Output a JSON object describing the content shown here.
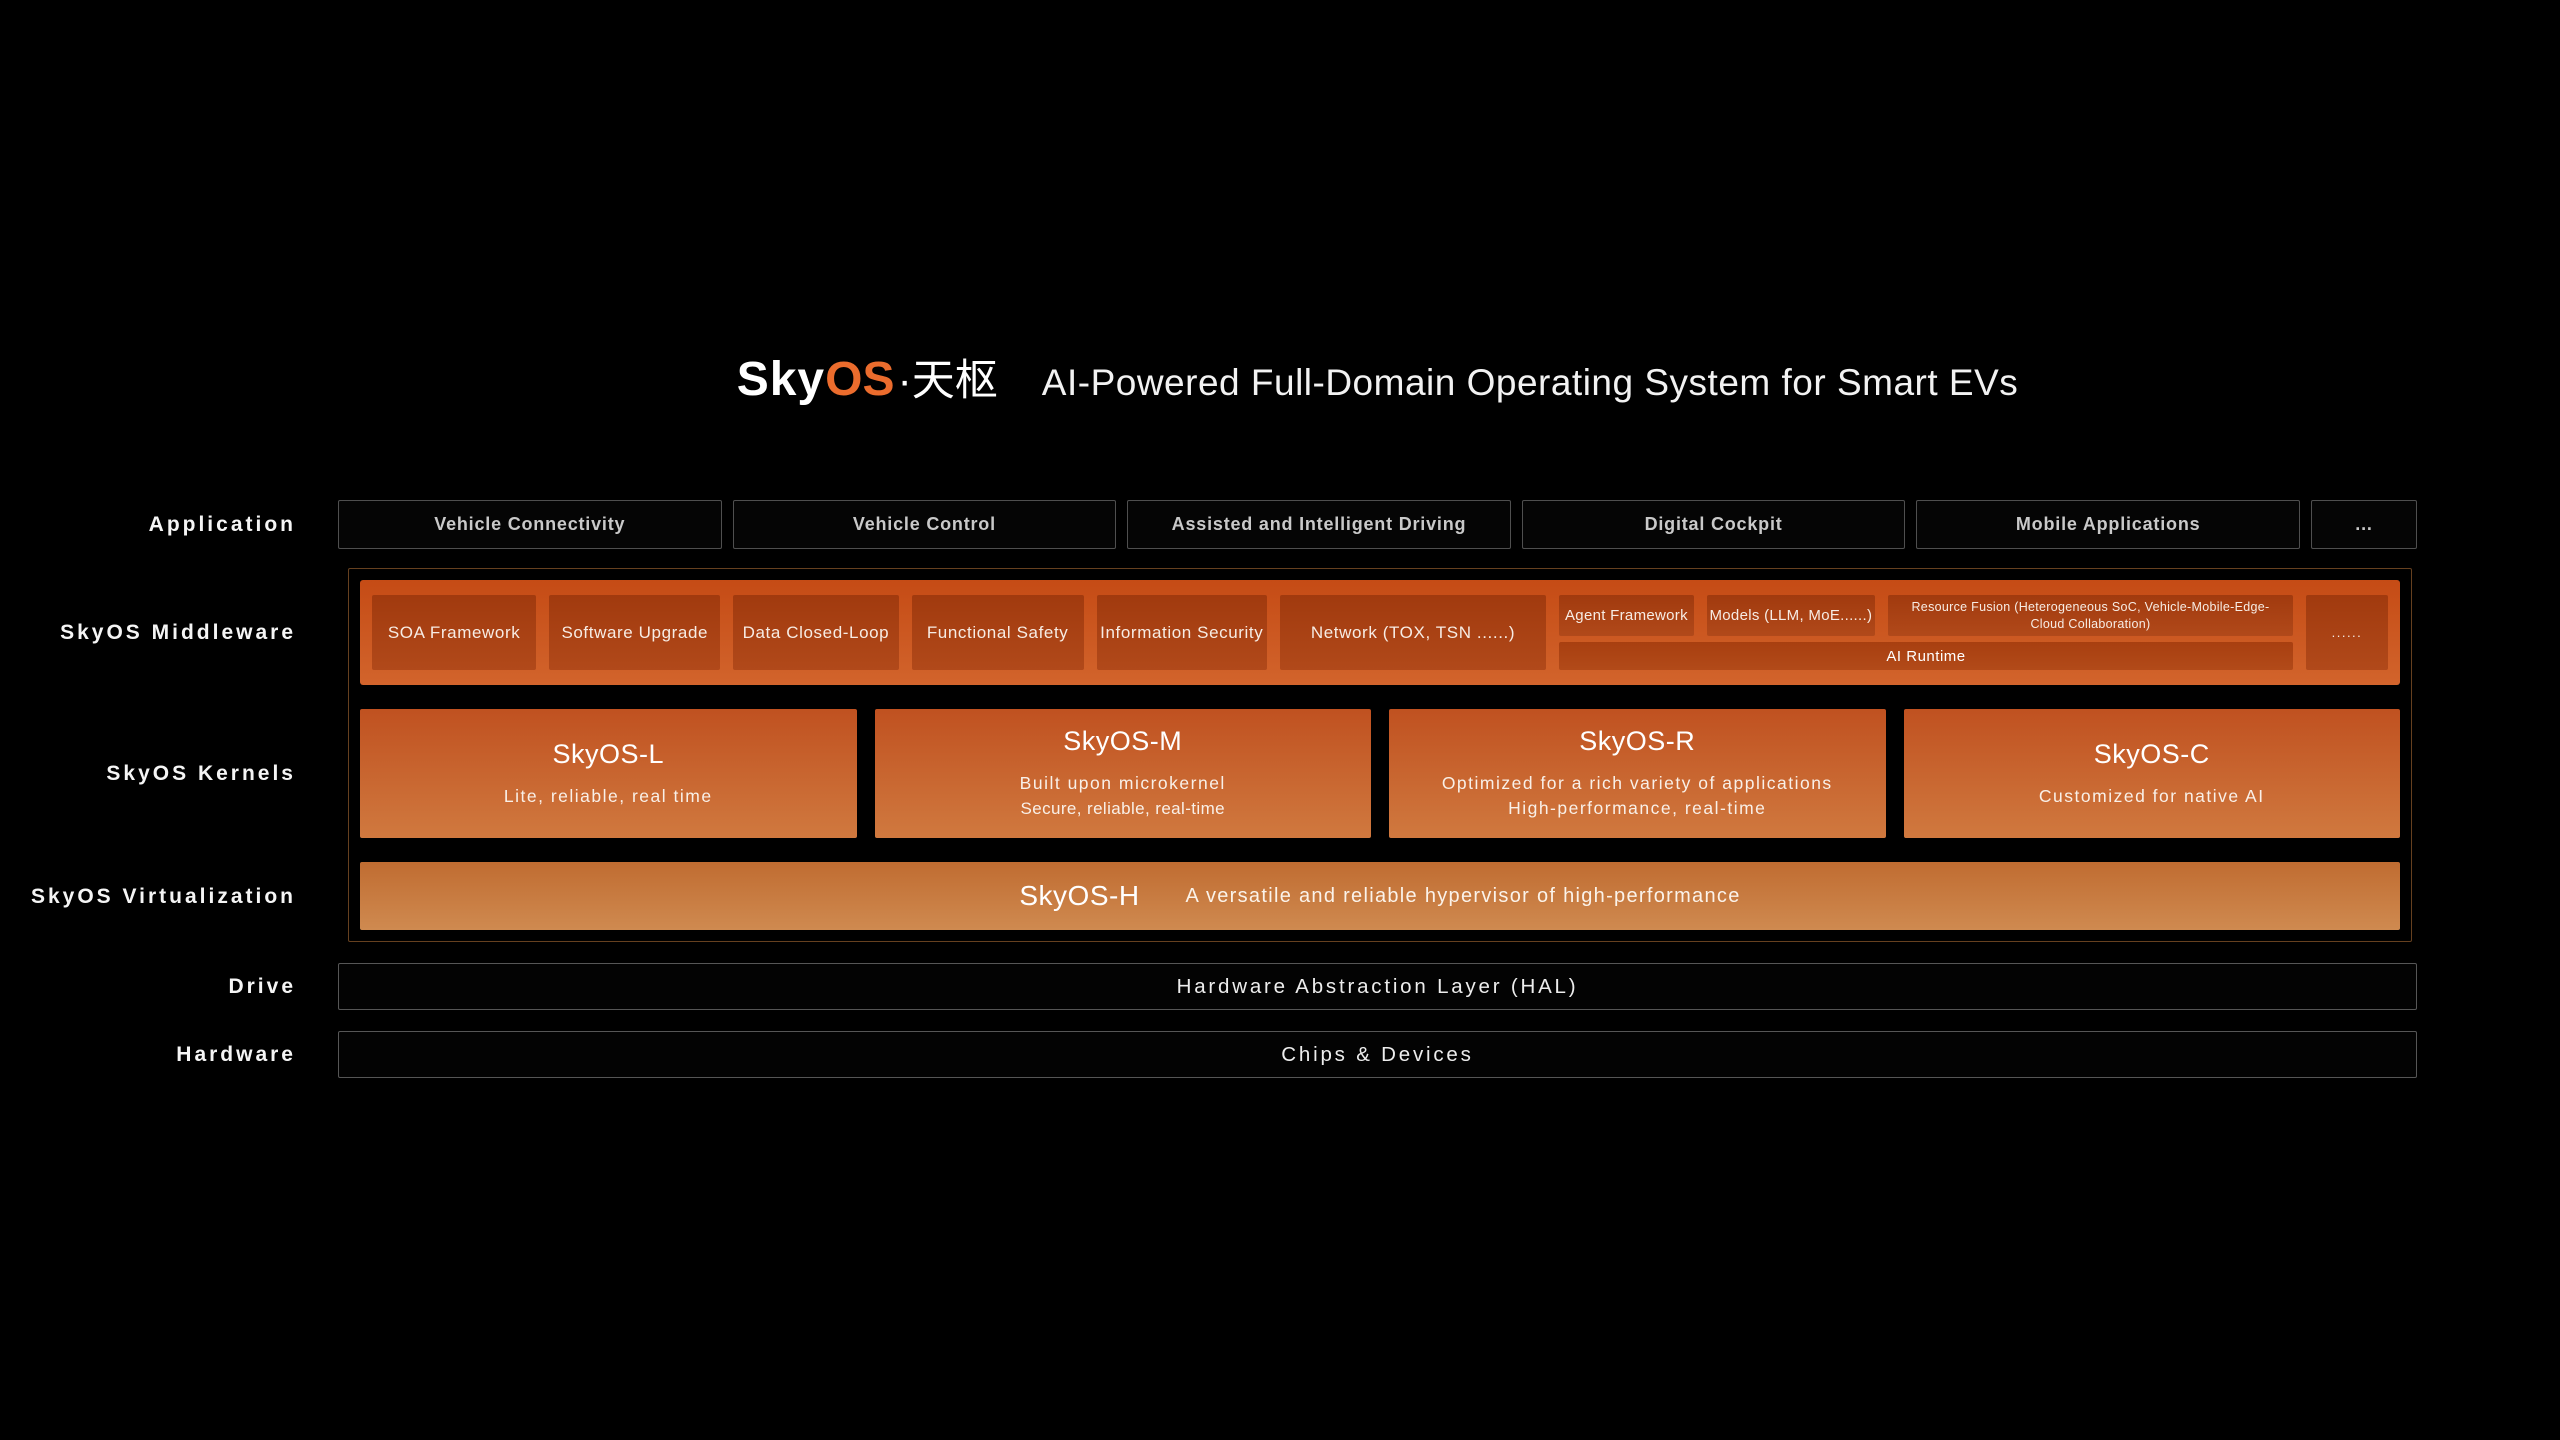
{
  "title": {
    "logo_sky": "Sky",
    "logo_os": "OS",
    "logo_cn": "·天枢",
    "subtitle": "AI-Powered Full-Domain Operating System for Smart EVs"
  },
  "rows": {
    "application": {
      "label": "Application",
      "items": [
        "Vehicle Connectivity",
        "Vehicle Control",
        "Assisted and Intelligent Driving",
        "Digital Cockpit",
        "Mobile Applications",
        "..."
      ]
    },
    "middleware": {
      "label": "SkyOS Middleware",
      "items": [
        "SOA Framework",
        "Software Upgrade",
        "Data Closed-Loop",
        "Functional Safety",
        "Information Security",
        "Network (TOX, TSN ......)"
      ],
      "ai_items": [
        "Agent Framework",
        "Models (LLM, MoE......)",
        "Resource Fusion (Heterogeneous SoC, Vehicle-Mobile-Edge-Cloud Collaboration)"
      ],
      "ai_runtime": "AI Runtime",
      "more": "......"
    },
    "kernels": {
      "label": "SkyOS Kernels",
      "items": [
        {
          "name": "SkyOS-L",
          "desc": [
            "Lite, reliable, real time"
          ]
        },
        {
          "name": "SkyOS-M",
          "desc": [
            "Built upon microkernel",
            "Secure, reliable, real-time"
          ]
        },
        {
          "name": "SkyOS-R",
          "desc": [
            "Optimized for a rich variety of applications",
            "High-performance, real-time"
          ]
        },
        {
          "name": "SkyOS-C",
          "desc": [
            "Customized for native AI"
          ]
        }
      ]
    },
    "virtualization": {
      "label": "SkyOS Virtualization",
      "name": "SkyOS-H",
      "desc": "A versatile and reliable hypervisor of high-performance"
    },
    "drive": {
      "label": "Drive",
      "value": "Hardware Abstraction Layer (HAL)"
    },
    "hardware": {
      "label": "Hardware",
      "value": "Chips & Devices"
    }
  },
  "colors": {
    "background": "#000000",
    "logo_orange": "#eb6c2d",
    "middleware_strip_top": "#c54b15",
    "middleware_strip_bottom": "#d2642c",
    "middleware_box_top": "#a13a0e",
    "middleware_box_bottom": "#b1491a",
    "kernel_top": "#c05120",
    "kernel_bottom": "#d0793f",
    "virtualization_top": "#c06c31",
    "virtualization_bottom": "#cf8a50",
    "outer_border": "#66401f",
    "bar_border": "#565656",
    "app_text": "#c9c9c9",
    "label_text": "#f5f5f5"
  }
}
